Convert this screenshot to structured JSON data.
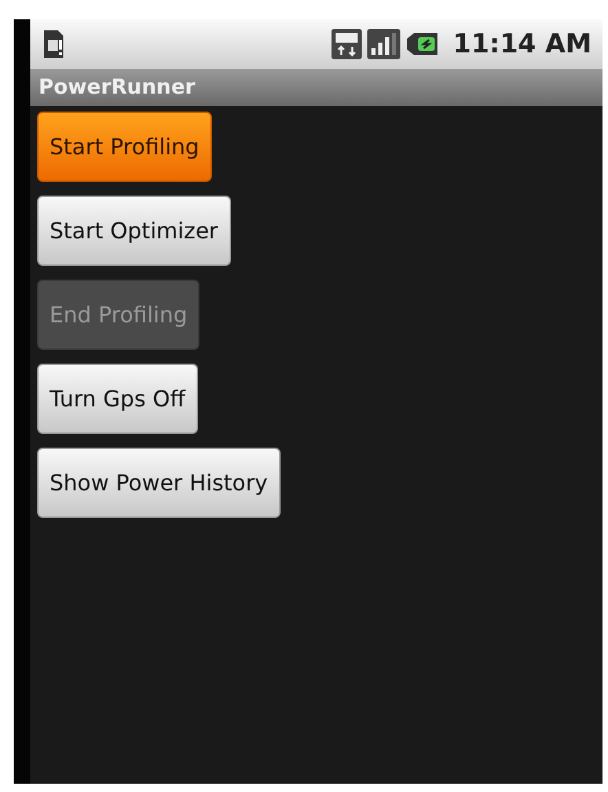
{
  "status_bar": {
    "time": "11:14 AM"
  },
  "title_bar": {
    "title": "PowerRunner"
  },
  "buttons": [
    {
      "label": "Start Profiling",
      "focused": true,
      "disabled": false
    },
    {
      "label": "Start Optimizer",
      "focused": false,
      "disabled": false
    },
    {
      "label": "End Profiling",
      "focused": false,
      "disabled": true
    },
    {
      "label": "Turn Gps Off",
      "focused": false,
      "disabled": false
    },
    {
      "label": "Show Power History",
      "focused": false,
      "disabled": false
    }
  ]
}
